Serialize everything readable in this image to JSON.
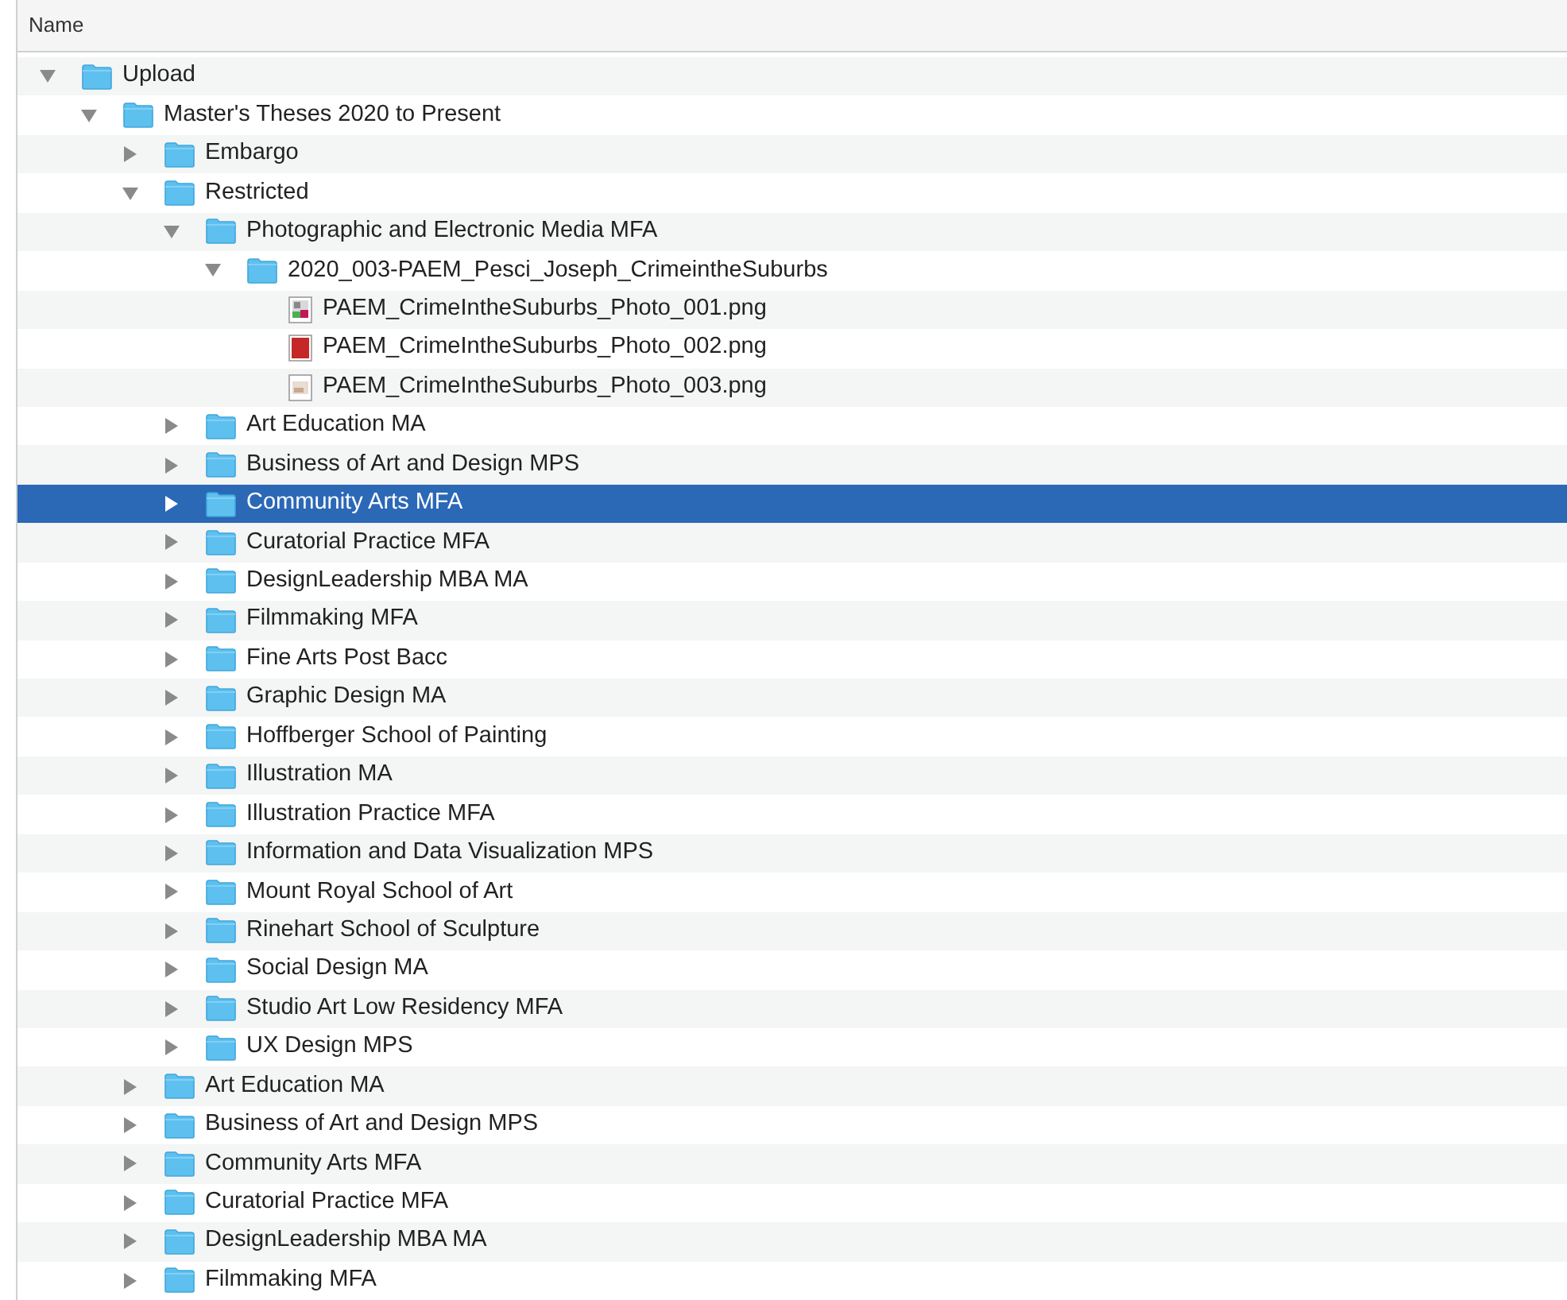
{
  "column_header": "Name",
  "tree": [
    {
      "name": "Upload",
      "kind": "folder",
      "expanded": true,
      "selected": false,
      "children": [
        {
          "name": "Master's Theses 2020 to Present",
          "kind": "folder",
          "expanded": true,
          "selected": false,
          "children": [
            {
              "name": "Embargo",
              "kind": "folder",
              "expanded": false,
              "selected": false
            },
            {
              "name": "Restricted",
              "kind": "folder",
              "expanded": true,
              "selected": false,
              "children": [
                {
                  "name": "Photographic and Electronic Media MFA",
                  "kind": "folder",
                  "expanded": true,
                  "selected": false,
                  "children": [
                    {
                      "name": "2020_003-PAEM_Pesci_Joseph_CrimeintheSuburbs",
                      "kind": "folder",
                      "expanded": true,
                      "selected": false,
                      "children": [
                        {
                          "name": "PAEM_CrimeIntheSuburbs_Photo_001.png",
                          "kind": "file",
                          "selected": false
                        },
                        {
                          "name": "PAEM_CrimeIntheSuburbs_Photo_002.png",
                          "kind": "file",
                          "selected": false
                        },
                        {
                          "name": "PAEM_CrimeIntheSuburbs_Photo_003.png",
                          "kind": "file",
                          "selected": false
                        }
                      ]
                    }
                  ]
                },
                {
                  "name": "Art Education MA",
                  "kind": "folder",
                  "expanded": false,
                  "selected": false
                },
                {
                  "name": "Business of Art and Design MPS",
                  "kind": "folder",
                  "expanded": false,
                  "selected": false
                },
                {
                  "name": "Community Arts MFA",
                  "kind": "folder",
                  "expanded": false,
                  "selected": true
                },
                {
                  "name": "Curatorial Practice MFA",
                  "kind": "folder",
                  "expanded": false,
                  "selected": false
                },
                {
                  "name": "DesignLeadership MBA MA",
                  "kind": "folder",
                  "expanded": false,
                  "selected": false
                },
                {
                  "name": "Filmmaking MFA",
                  "kind": "folder",
                  "expanded": false,
                  "selected": false
                },
                {
                  "name": "Fine Arts Post Bacc",
                  "kind": "folder",
                  "expanded": false,
                  "selected": false
                },
                {
                  "name": "Graphic Design MA",
                  "kind": "folder",
                  "expanded": false,
                  "selected": false
                },
                {
                  "name": "Hoffberger School of Painting",
                  "kind": "folder",
                  "expanded": false,
                  "selected": false
                },
                {
                  "name": "Illustration MA",
                  "kind": "folder",
                  "expanded": false,
                  "selected": false
                },
                {
                  "name": "Illustration Practice MFA",
                  "kind": "folder",
                  "expanded": false,
                  "selected": false
                },
                {
                  "name": "Information and Data Visualization MPS",
                  "kind": "folder",
                  "expanded": false,
                  "selected": false
                },
                {
                  "name": "Mount Royal School of Art",
                  "kind": "folder",
                  "expanded": false,
                  "selected": false
                },
                {
                  "name": "Rinehart School of Sculpture",
                  "kind": "folder",
                  "expanded": false,
                  "selected": false
                },
                {
                  "name": "Social Design MA",
                  "kind": "folder",
                  "expanded": false,
                  "selected": false
                },
                {
                  "name": "Studio Art Low Residency MFA",
                  "kind": "folder",
                  "expanded": false,
                  "selected": false
                },
                {
                  "name": "UX Design MPS",
                  "kind": "folder",
                  "expanded": false,
                  "selected": false
                }
              ]
            },
            {
              "name": "Art Education MA",
              "kind": "folder",
              "expanded": false,
              "selected": false
            },
            {
              "name": "Business of Art and Design MPS",
              "kind": "folder",
              "expanded": false,
              "selected": false
            },
            {
              "name": "Community Arts MFA",
              "kind": "folder",
              "expanded": false,
              "selected": false
            },
            {
              "name": "Curatorial Practice MFA",
              "kind": "folder",
              "expanded": false,
              "selected": false
            },
            {
              "name": "DesignLeadership MBA MA",
              "kind": "folder",
              "expanded": false,
              "selected": false
            },
            {
              "name": "Filmmaking MFA",
              "kind": "folder",
              "expanded": false,
              "selected": false
            }
          ]
        }
      ]
    }
  ]
}
